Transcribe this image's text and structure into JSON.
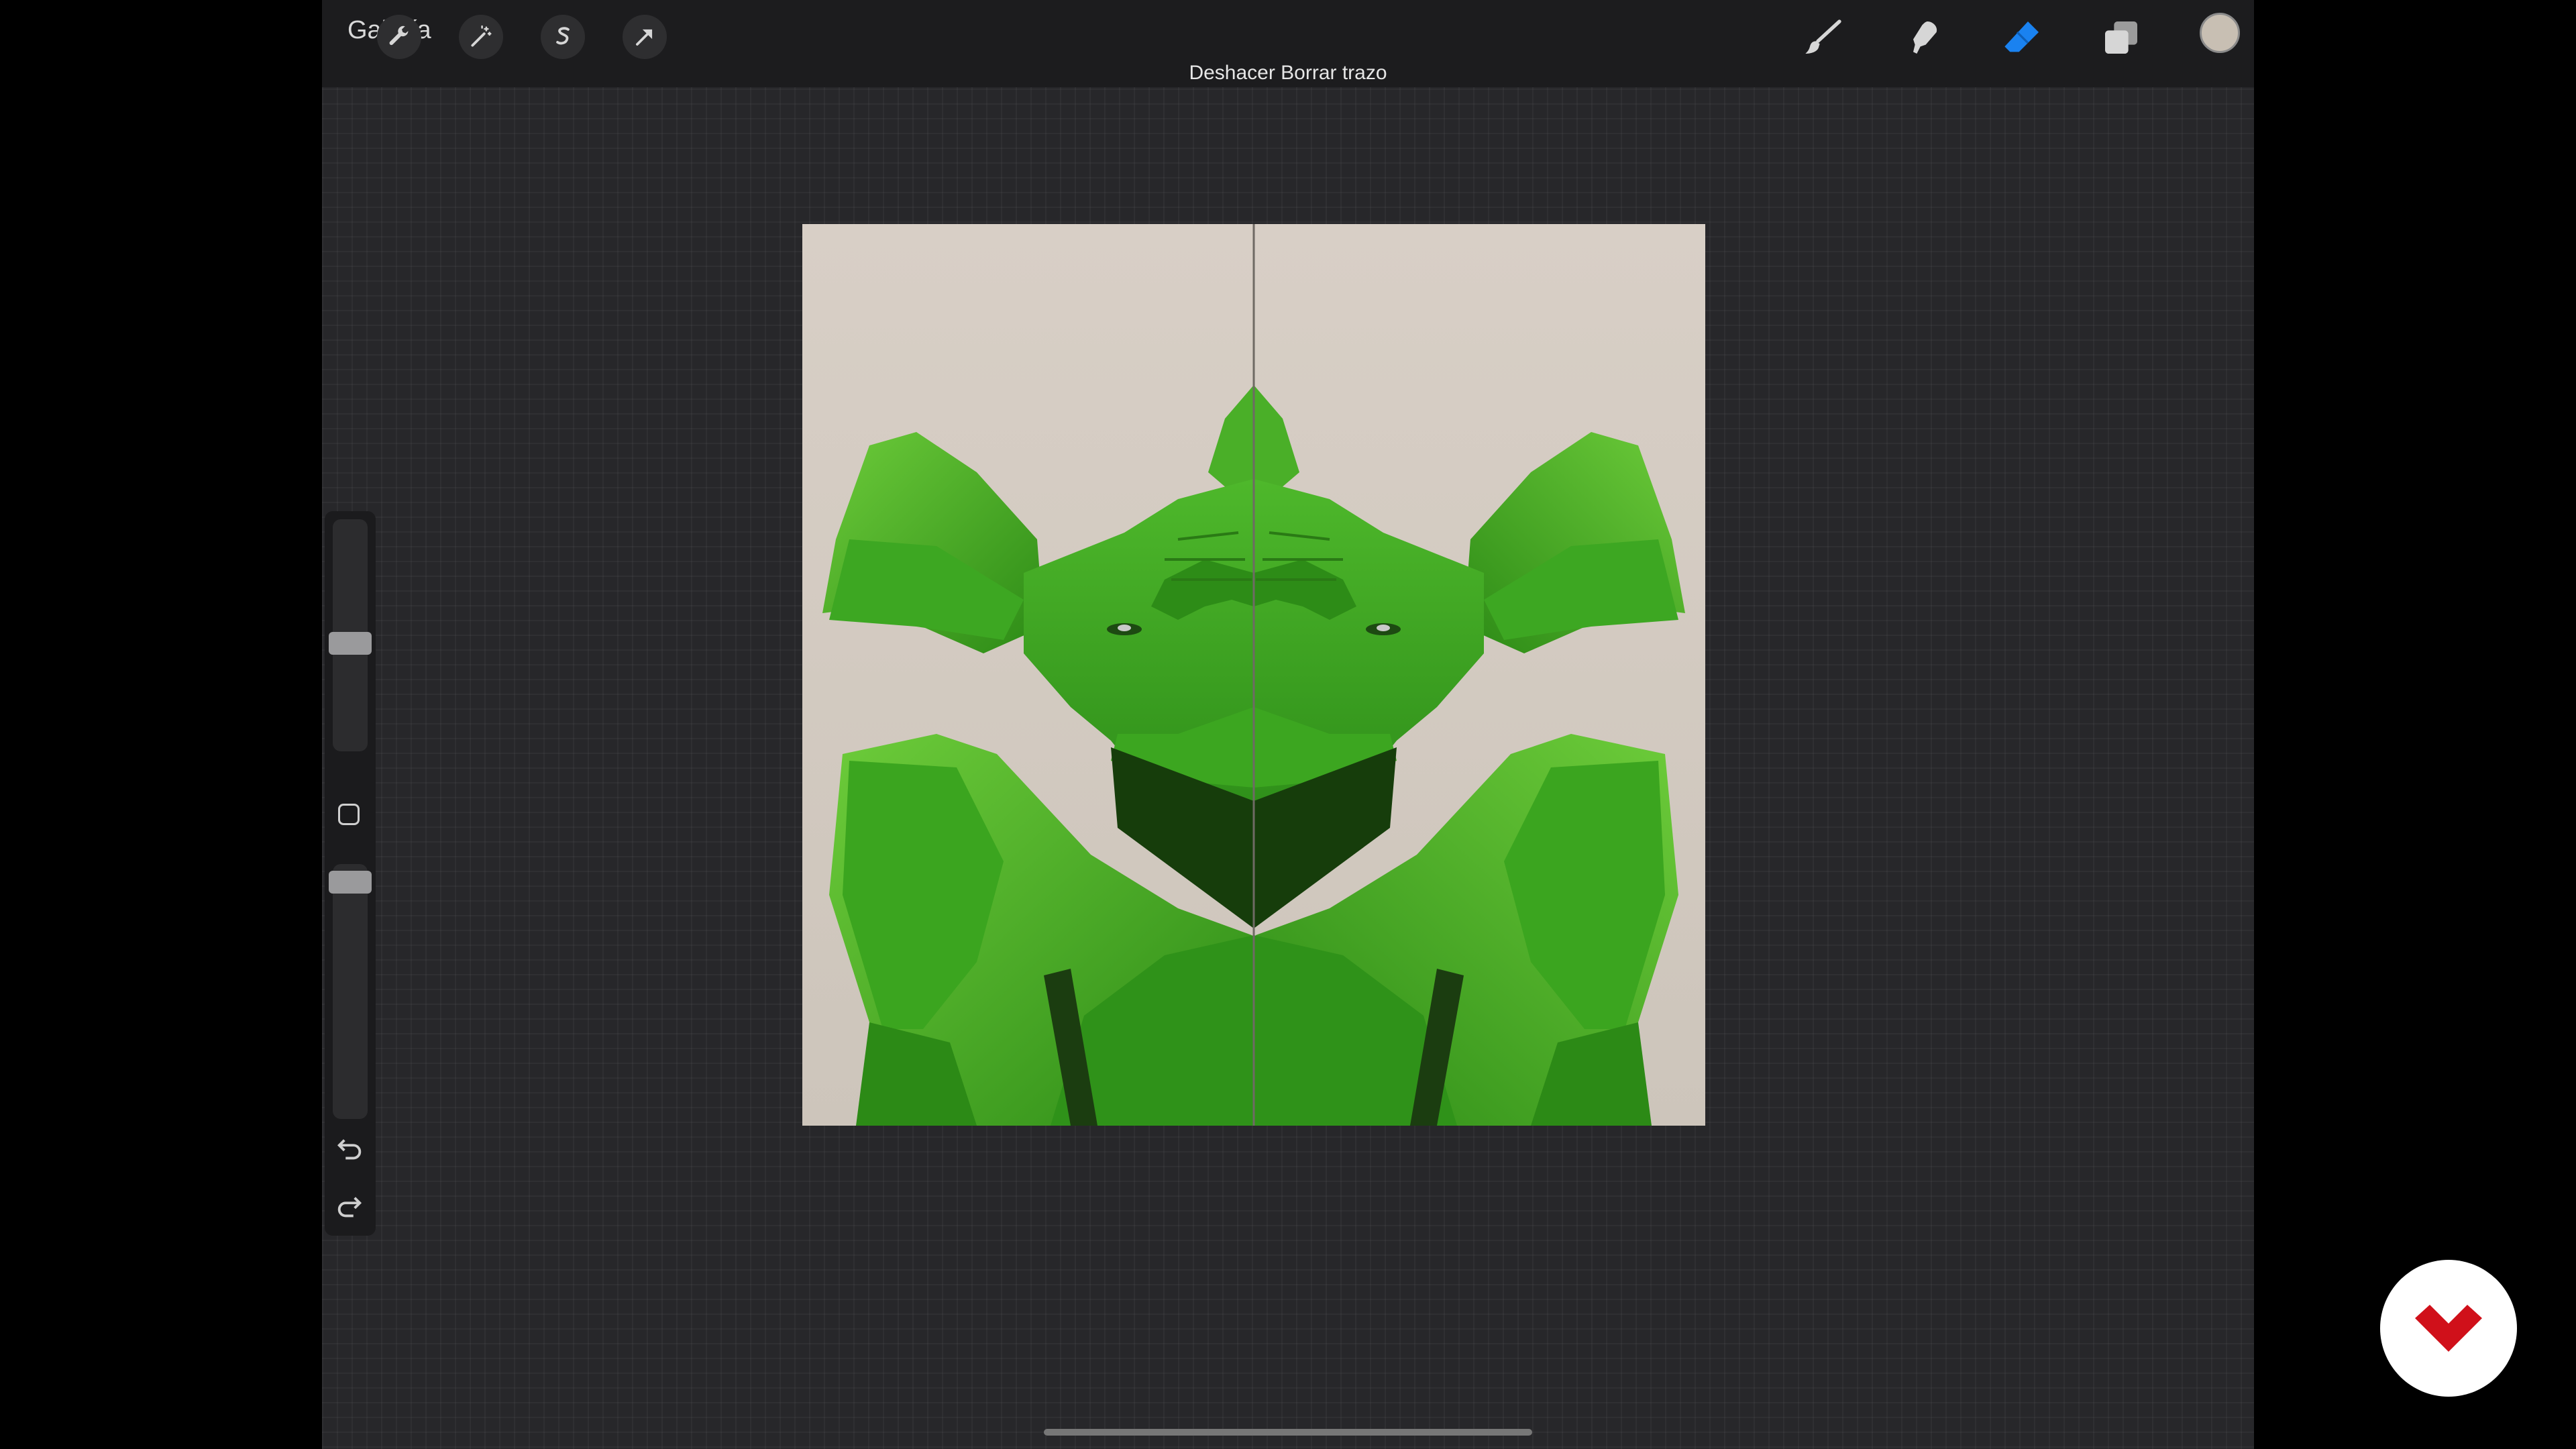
{
  "app": {
    "gallery_label": "Galería",
    "undo_message": "Deshacer Borrar trazo"
  },
  "toolbar": {
    "left_tools": [
      "wrench-icon",
      "magic-wand-icon",
      "selection-s-icon",
      "transform-arrow-icon"
    ],
    "right_tools": [
      "brush-icon",
      "smudge-icon",
      "eraser-icon",
      "layers-icon"
    ],
    "active_tool": "eraser-icon",
    "active_color": "#1a82f0",
    "current_color": "#c8bfb3"
  },
  "sidebar": {
    "brush_size_icon": "slider-size",
    "opacity_icon": "slider-opacity",
    "modifier_icon": "square-modifier-icon",
    "undo_icon": "undo-icon",
    "redo_icon": "redo-icon"
  },
  "canvas": {
    "background": "#d3cbc1",
    "artwork": "symmetrical-green-figure",
    "symmetry_guide": true
  },
  "brand_badge": {
    "icon": "brand-logo-icon",
    "color": "#d0101a"
  }
}
